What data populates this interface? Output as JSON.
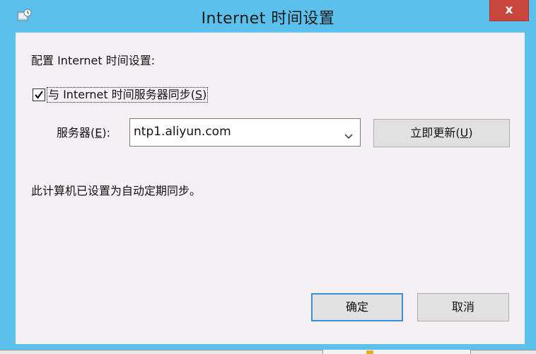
{
  "window": {
    "title": "Internet 时间设置",
    "close_label": "x",
    "title_icon": "clock-settings-icon"
  },
  "heading": "配置 Internet 时间设置:",
  "sync": {
    "checked": true,
    "label_prefix": "与 Internet 时间服务器同步(",
    "label_accel": "S",
    "label_suffix": ")"
  },
  "server": {
    "label_prefix": "服务器(",
    "label_accel": "E",
    "label_suffix": "):",
    "value": "ntp1.aliyun.com",
    "icon": "chevron-down-icon"
  },
  "update_button": {
    "label_prefix": "立即更新(",
    "label_accel": "U",
    "label_suffix": ")"
  },
  "status_text": "此计算机已设置为自动定期同步。",
  "buttons": {
    "ok_label": "确定",
    "cancel_label": "取消"
  },
  "colors": {
    "titlebar": "#5bc0eb",
    "close": "#c9463d",
    "client": "#f5f0f4",
    "focus_border": "#3c8fd6"
  }
}
